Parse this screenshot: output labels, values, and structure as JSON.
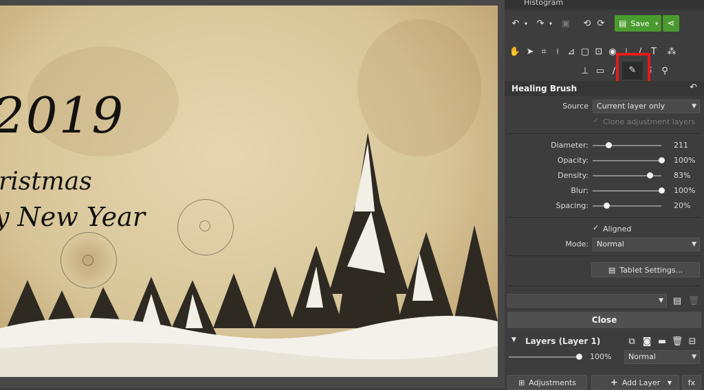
{
  "panel": {
    "top_tab_label": "Histogram",
    "save_label": "Save",
    "tool_title": "Healing Brush",
    "source": {
      "label": "Source",
      "value": "Current layer only"
    },
    "clone_adjustment": {
      "label": "Clone adjustment layers",
      "checked": true
    },
    "sliders": [
      {
        "label": "Diameter:",
        "value": "211",
        "fraction": 0.23
      },
      {
        "label": "Opacity:",
        "value": "100%",
        "fraction": 1.0
      },
      {
        "label": "Density:",
        "value": "83%",
        "fraction": 0.83
      },
      {
        "label": "Blur:",
        "value": "100%",
        "fraction": 1.0
      },
      {
        "label": "Spacing:",
        "value": "20%",
        "fraction": 0.2
      }
    ],
    "aligned": {
      "label": "Aligned",
      "checked": true
    },
    "mode": {
      "label": "Mode:",
      "value": "Normal"
    },
    "tablet_settings_label": "Tablet Settings...",
    "close_label": "Close",
    "layers": {
      "title": "Layers (Layer 1)",
      "opacity_value": "100%",
      "opacity_fraction": 1.0,
      "blend_mode": "Normal"
    },
    "adjustments_label": "Adjustments",
    "add_layer_label": "Add Layer",
    "fx_label": "fx"
  },
  "canvas": {
    "year": "2019",
    "line1": "ristmas",
    "line2": "y New Year"
  },
  "colors": {
    "accent_green": "#4a9b2f",
    "highlight_red": "#e21b1b"
  }
}
